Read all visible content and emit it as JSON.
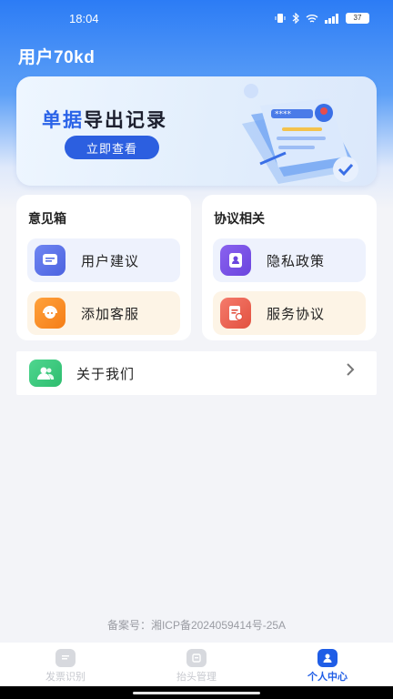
{
  "status_bar": {
    "time": "18:04",
    "battery": "37"
  },
  "user": {
    "name": "用户70kd"
  },
  "banner": {
    "title_accent": "单据",
    "title_rest": "导出记录",
    "button_label": "立即查看",
    "art_text": "****"
  },
  "feedback_card": {
    "title": "意见箱",
    "items": [
      {
        "label": "用户建议",
        "icon": "message-icon"
      },
      {
        "label": "添加客服",
        "icon": "customer-service-icon"
      }
    ]
  },
  "agreement_card": {
    "title": "协议相关",
    "items": [
      {
        "label": "隐私政策",
        "icon": "privacy-icon"
      },
      {
        "label": "服务协议",
        "icon": "agreement-icon"
      }
    ]
  },
  "about": {
    "label": "关于我们",
    "icon": "users-icon"
  },
  "footer": {
    "icp": "备案号：湘ICP备2024059414号-25A"
  },
  "tabbar": {
    "tabs": [
      {
        "label": "发票识别",
        "active": false
      },
      {
        "label": "抬头管理",
        "active": false
      },
      {
        "label": "个人中心",
        "active": true
      }
    ]
  },
  "colors": {
    "primary": "#2c5fe0",
    "active_tab": "#1f5de6",
    "header_blue": "#2c7cf5"
  }
}
